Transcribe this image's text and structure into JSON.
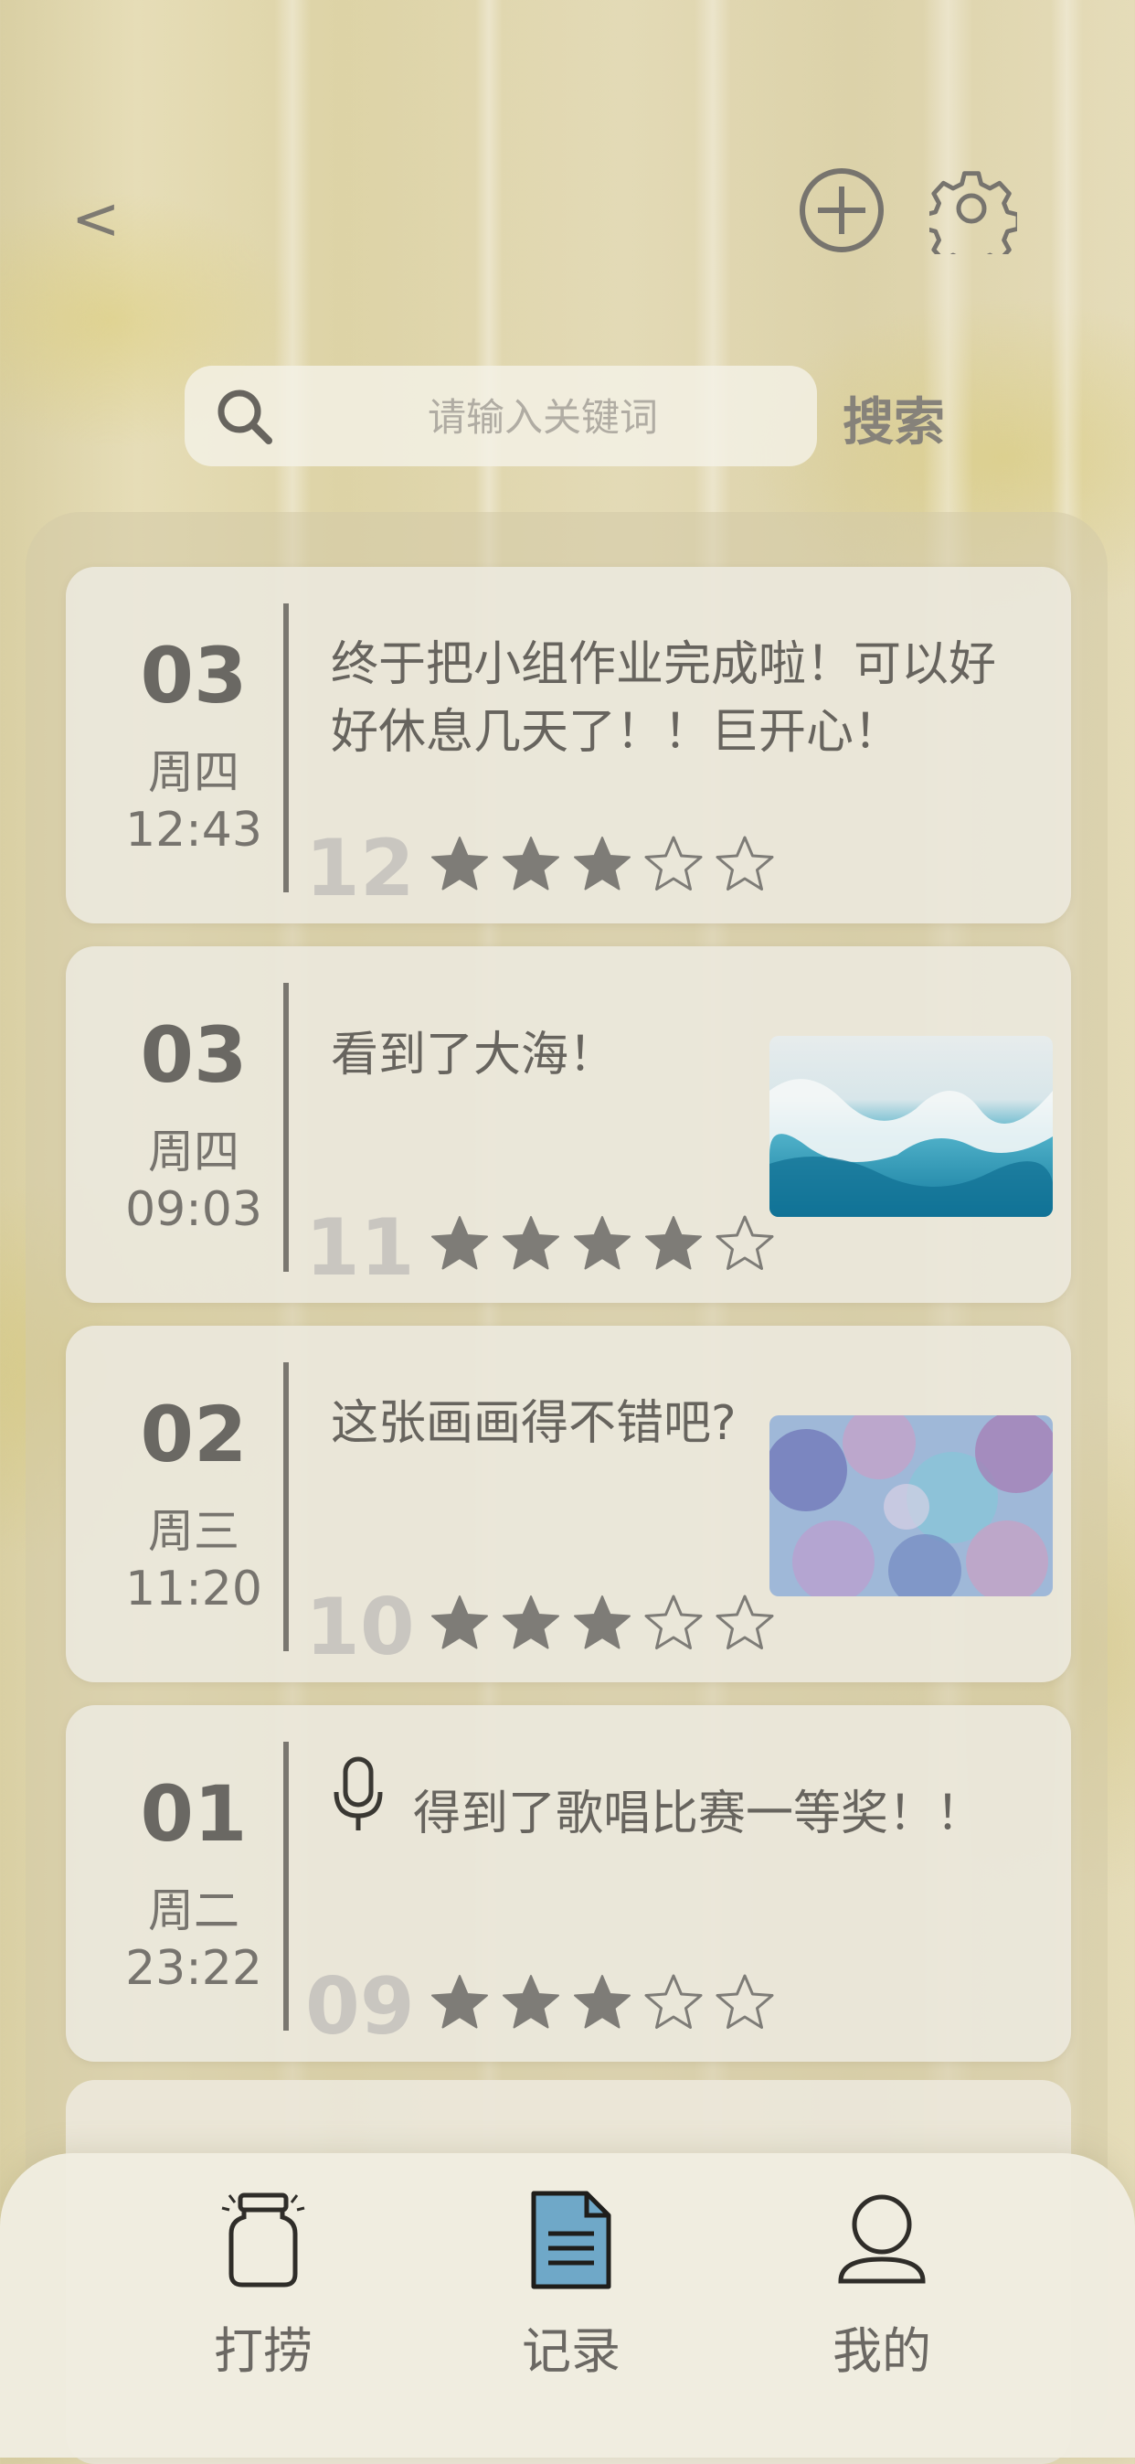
{
  "header": {
    "back_label": "<",
    "add_icon": "plus-circle-icon",
    "settings_icon": "gear-icon"
  },
  "search": {
    "placeholder": "请输入关键词",
    "button_label": "搜索"
  },
  "entries": [
    {
      "day": "03",
      "weekday": "周四",
      "time": "12:43",
      "text_line1": "终于把小组作业完成啦！可以好",
      "text_line2": "好休息几天了！！巨开心！",
      "count": "12",
      "rating": 3,
      "max_rating": 5
    },
    {
      "day": "03",
      "weekday": "周四",
      "time": "09:03",
      "text_line1": "看到了大海！",
      "text_line2": "",
      "count": "11",
      "rating": 4,
      "max_rating": 5,
      "thumbnail": "sea-photo"
    },
    {
      "day": "02",
      "weekday": "周三",
      "time": "11:20",
      "text_line1": "这张画画得不错吧?",
      "text_line2": "",
      "count": "10",
      "rating": 3,
      "max_rating": 5,
      "thumbnail": "painting-photo"
    },
    {
      "day": "01",
      "weekday": "周二",
      "time": "23:22",
      "text_line1": "得到了歌唱比赛一等奖！！",
      "text_line2": "",
      "count": "09",
      "rating": 3,
      "max_rating": 5,
      "attachment_icon": "microphone-icon"
    }
  ],
  "bottom_nav": {
    "items": [
      {
        "label": "打捞",
        "icon": "jar-icon",
        "active": false
      },
      {
        "label": "记录",
        "icon": "document-icon",
        "active": true
      },
      {
        "label": "我的",
        "icon": "person-icon",
        "active": false
      }
    ]
  },
  "colors": {
    "text": "#67645e",
    "accent_document": "#6fa8c8",
    "star_filled": "#7e7c77",
    "count_faded": "#c9c6c0"
  }
}
